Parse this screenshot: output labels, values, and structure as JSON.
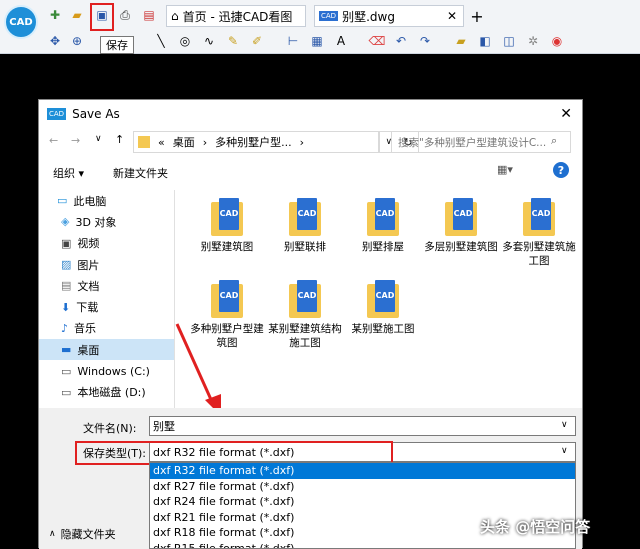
{
  "app": {
    "logo_text": "CAD",
    "tab_home": "首页 - 迅捷CAD看图",
    "tab_doc": "别墅.dwg",
    "doc_tab_icon": "CAD",
    "tooltip_save": "保存",
    "colors": {
      "highlight": "#e02020",
      "accent": "#1e8fd8"
    }
  },
  "dialog": {
    "title": "Save As",
    "title_icon": "CAD",
    "path": [
      "«",
      "桌面",
      "›",
      "多种别墅户型...",
      "›"
    ],
    "search_placeholder": "搜索\"多种别墅户型建筑设计C...",
    "organize_label": "组织 ▾",
    "new_folder_label": "新建文件夹",
    "sidebar": [
      {
        "label": "此电脑",
        "icon": "computer-icon"
      },
      {
        "label": "3D 对象",
        "icon": "cube-icon"
      },
      {
        "label": "视频",
        "icon": "video-icon"
      },
      {
        "label": "图片",
        "icon": "picture-icon"
      },
      {
        "label": "文档",
        "icon": "document-icon"
      },
      {
        "label": "下载",
        "icon": "download-icon"
      },
      {
        "label": "音乐",
        "icon": "music-icon"
      },
      {
        "label": "桌面",
        "icon": "desktop-icon"
      },
      {
        "label": "Windows (C:)",
        "icon": "drive-icon"
      },
      {
        "label": "本地磁盘 (D:)",
        "icon": "drive-icon"
      }
    ],
    "files": [
      {
        "name": "别墅建筑图"
      },
      {
        "name": "别墅联排"
      },
      {
        "name": "别墅排屋"
      },
      {
        "name": "多层别墅建筑图"
      },
      {
        "name": "多套别墅建筑施工图"
      },
      {
        "name": "多种别墅户型建筑图"
      },
      {
        "name": "某别墅建筑结构施工图"
      },
      {
        "name": "某别墅施工图"
      }
    ],
    "file_icon_text": "CAD",
    "filename_label": "文件名(N):",
    "filename_value": "别墅",
    "filetype_label": "保存类型(T):",
    "filetype_value": "dxf R32 file format (*.dxf)",
    "filetype_options": [
      "dxf R32 file format (*.dxf)",
      "dxf R27 file format (*.dxf)",
      "dxf R24 file format (*.dxf)",
      "dxf R21 file format (*.dxf)",
      "dxf R18 file format (*.dxf)",
      "dxf R15 file format (*.dxf)"
    ],
    "hide_folders_label": "隐藏文件夹"
  },
  "watermark": "头条 @悟空问答"
}
